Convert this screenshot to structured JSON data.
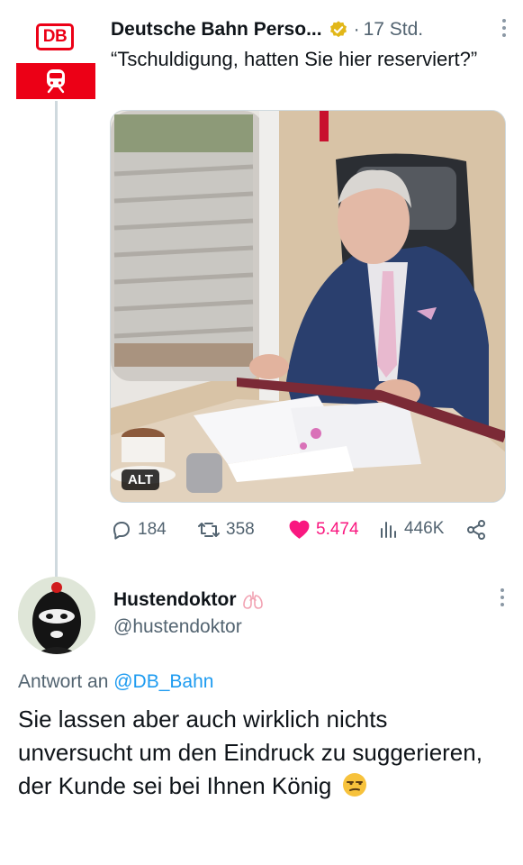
{
  "tweet": {
    "author_name": "Deutsche Bahn Perso...",
    "separator": "·",
    "time": "17 Std.",
    "text": "“Tschuldigung, hatten Sie hier reserviert?”",
    "avatar_logo": "DB",
    "media": {
      "alt_badge": "ALT",
      "icon": "photo-of-man-in-train-seat"
    },
    "actions": {
      "replies": "184",
      "retweets": "358",
      "likes": "5.474",
      "views": "446K"
    },
    "colors": {
      "db_red": "#ec0016",
      "like_pink": "#f91880",
      "verified_gold": "#e2b719",
      "link_blue": "#1d9bf0"
    }
  },
  "reply": {
    "author_name": "Hustendoktor",
    "handle": "@hustendoktor",
    "replying_to_prefix": "Antwort an",
    "replying_to_handle": "@DB_Bahn",
    "text": "Sie lassen aber auch wirklich nichts unversucht um den Eindruck zu suggerieren, der Kunde sei bei Ihnen König",
    "emoji": "unamused-face"
  }
}
